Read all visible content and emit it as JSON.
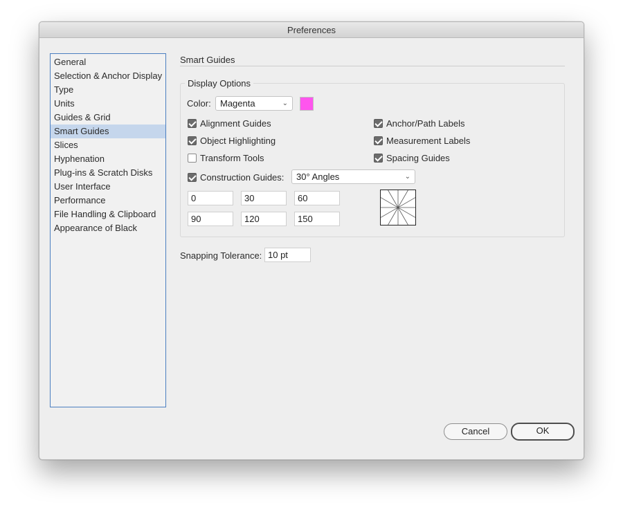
{
  "window": {
    "title": "Preferences"
  },
  "sidebar": {
    "items": [
      {
        "label": "General"
      },
      {
        "label": "Selection & Anchor Display"
      },
      {
        "label": "Type"
      },
      {
        "label": "Units"
      },
      {
        "label": "Guides & Grid"
      },
      {
        "label": "Smart Guides",
        "selected": true
      },
      {
        "label": "Slices"
      },
      {
        "label": "Hyphenation"
      },
      {
        "label": "Plug-ins & Scratch Disks"
      },
      {
        "label": "User Interface"
      },
      {
        "label": "Performance"
      },
      {
        "label": "File Handling & Clipboard"
      },
      {
        "label": "Appearance of Black"
      }
    ]
  },
  "main": {
    "section_title": "Smart Guides",
    "display_options": {
      "title": "Display Options",
      "color_label": "Color:",
      "color_value": "Magenta",
      "color_swatch": "#ff55ee",
      "checkboxes_left": [
        {
          "label": "Alignment Guides",
          "checked": true
        },
        {
          "label": "Object Highlighting",
          "checked": true
        },
        {
          "label": "Transform Tools",
          "checked": false
        }
      ],
      "checkboxes_right": [
        {
          "label": "Anchor/Path Labels",
          "checked": true
        },
        {
          "label": "Measurement Labels",
          "checked": true
        },
        {
          "label": "Spacing Guides",
          "checked": true
        }
      ],
      "construction_guides": {
        "label": "Construction Guides:",
        "checked": true,
        "selected": "30° Angles",
        "angles": [
          "0",
          "30",
          "60",
          "90",
          "120",
          "150"
        ]
      }
    },
    "snapping_tolerance": {
      "label": "Snapping Tolerance:",
      "value": "10 pt"
    }
  },
  "footer": {
    "cancel_label": "Cancel",
    "ok_label": "OK"
  }
}
